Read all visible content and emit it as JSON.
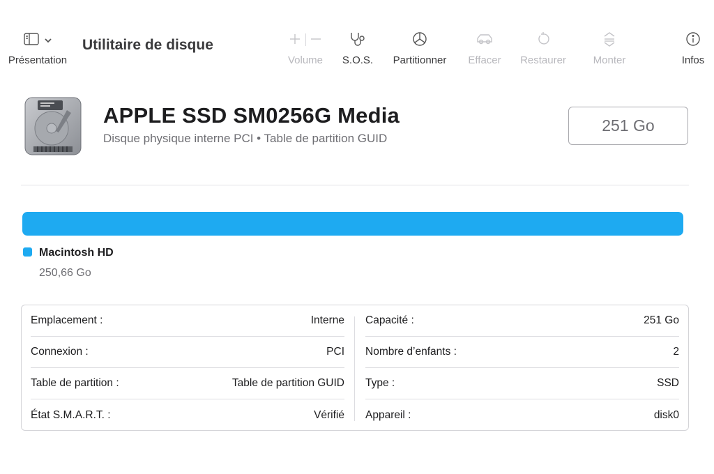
{
  "toolbar": {
    "presentation_label": "Présentation",
    "app_title": "Utilitaire de disque",
    "volume_label": "Volume",
    "sos_label": "S.O.S.",
    "partition_label": "Partitionner",
    "erase_label": "Effacer",
    "restore_label": "Restaurer",
    "mount_label": "Monter",
    "info_label": "Infos"
  },
  "disk": {
    "title": "APPLE SSD SM0256G Media",
    "subtitle": "Disque physique interne PCI • Table de partition GUID",
    "capacity": "251 Go"
  },
  "usage": {
    "fill_fraction": 1.0,
    "color": "#1eaaf1",
    "volume_name": "Macintosh HD",
    "volume_size": "250,66 Go"
  },
  "info": {
    "left": [
      {
        "label": "Emplacement :",
        "value": "Interne"
      },
      {
        "label": "Connexion :",
        "value": "PCI"
      },
      {
        "label": "Table de partition :",
        "value": "Table de partition GUID"
      },
      {
        "label": "État S.M.A.R.T. :",
        "value": "Vérifié"
      }
    ],
    "right": [
      {
        "label": "Capacité :",
        "value": "251 Go"
      },
      {
        "label": "Nombre d’enfants :",
        "value": "2"
      },
      {
        "label": "Type :",
        "value": "SSD"
      },
      {
        "label": "Appareil :",
        "value": "disk0"
      }
    ]
  },
  "icons": [
    "sidebar-icon",
    "chevron-down-icon",
    "plus-icon",
    "minus-icon",
    "stethoscope-icon",
    "pie-chart-icon",
    "eraser-car-icon",
    "restore-icon",
    "mount-icon",
    "info-icon",
    "hard-drive-icon"
  ]
}
